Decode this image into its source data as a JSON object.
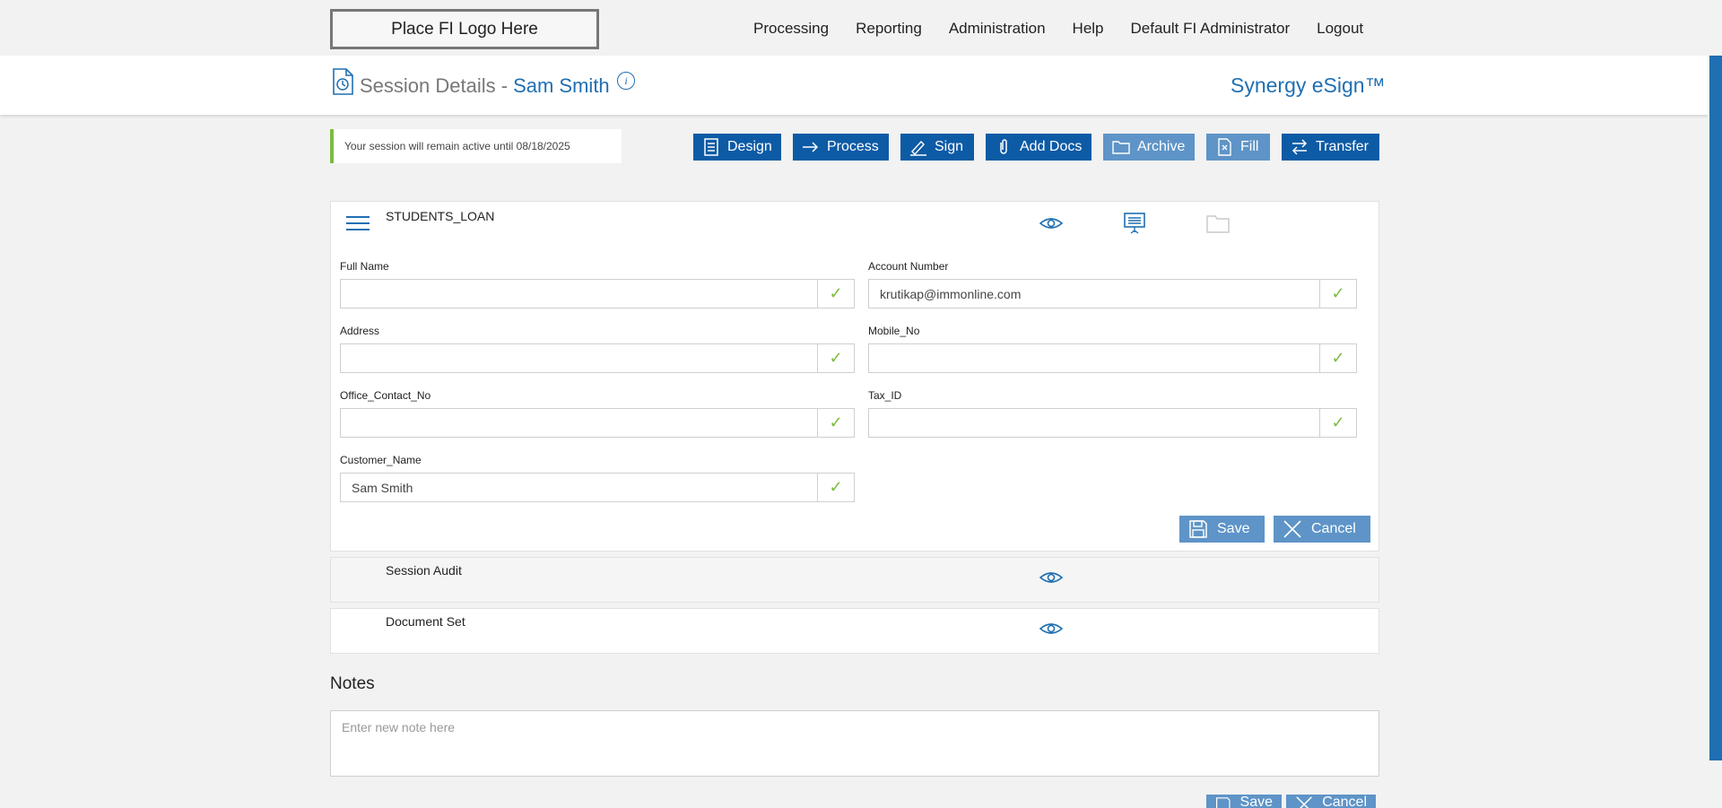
{
  "topbar": {
    "logo_text": "Place FI Logo Here",
    "nav": [
      "Processing",
      "Reporting",
      "Administration",
      "Help",
      "Default FI Administrator",
      "Logout"
    ]
  },
  "header": {
    "title_prefix": "Session Details -",
    "customer_name": "Sam Smith",
    "brand": "Synergy eSign™"
  },
  "status_message": "Your session will remain active until 08/18/2025",
  "actions": {
    "design": "Design",
    "process": "Process",
    "sign": "Sign",
    "add_docs": "Add Docs",
    "archive": "Archive",
    "fill": "Fill",
    "transfer": "Transfer"
  },
  "form_panel": {
    "title": "STUDENTS_LOAN",
    "fields": {
      "full_name": {
        "label": "Full Name",
        "value": ""
      },
      "account_number": {
        "label": "Account Number",
        "value": "krutikap@immonline.com"
      },
      "address": {
        "label": "Address",
        "value": ""
      },
      "mobile_no": {
        "label": "Mobile_No",
        "value": ""
      },
      "office_contact_no": {
        "label": "Office_Contact_No",
        "value": ""
      },
      "tax_id": {
        "label": "Tax_ID",
        "value": ""
      },
      "customer_name": {
        "label": "Customer_Name",
        "value": "Sam Smith"
      }
    },
    "check_glyph": "✓",
    "save_label": "Save",
    "cancel_label": "Cancel"
  },
  "session_audit": {
    "title": "Session Audit"
  },
  "document_set": {
    "title": "Document Set"
  },
  "notes": {
    "title": "Notes",
    "placeholder": "Enter new note here",
    "save_label": "Save",
    "cancel_label": "Cancel"
  },
  "colors": {
    "primary": "#0d5ba5",
    "primary_light": "#5e94c7",
    "link": "#1f6fb2",
    "success": "#7dbb42"
  }
}
